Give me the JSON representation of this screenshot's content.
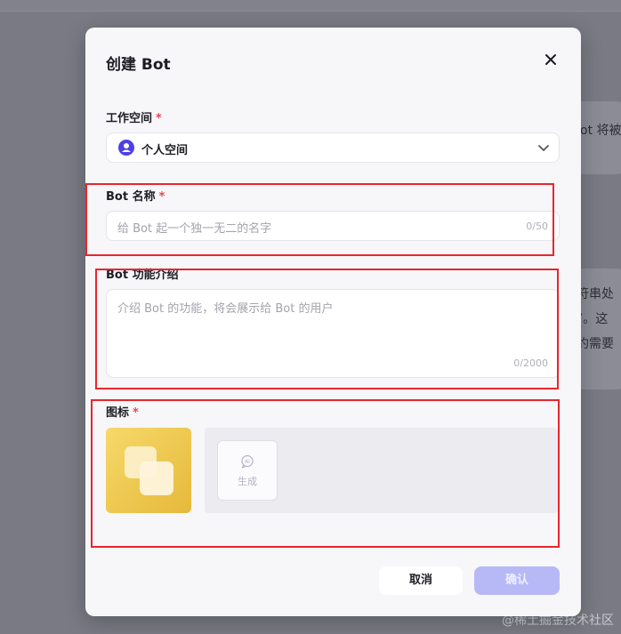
{
  "background": {
    "text_right_1": "ot 将被",
    "text_right_2": "符串处",
    "text_right_3": "”。这",
    "text_right_4": "约需要",
    "watermark": "@稀土掘金技术社区"
  },
  "dialog": {
    "title": "创建 Bot",
    "workspace": {
      "label": "工作空间",
      "required_mark": "*",
      "selected": "个人空间"
    },
    "name": {
      "label": "Bot 名称",
      "required_mark": "*",
      "placeholder": "给 Bot 起一个独一无二的名字",
      "counter": "0/50"
    },
    "description": {
      "label": "Bot 功能介绍",
      "placeholder": "介绍 Bot 的功能，将会展示给 Bot 的用户",
      "counter": "0/2000"
    },
    "icon": {
      "label": "图标",
      "required_mark": "*",
      "generate_label": "生成"
    },
    "buttons": {
      "cancel": "取消",
      "confirm": "确认"
    }
  },
  "colors": {
    "accent": "#4e40e5",
    "confirm_disabled": "#b7b9f6",
    "required": "#e5484d",
    "annotation_box": "#e8262d",
    "icon_tile": "#ecc94b"
  },
  "icons": [
    "close-icon",
    "user-avatar-icon",
    "chevron-down-icon",
    "ai-generate-icon"
  ]
}
